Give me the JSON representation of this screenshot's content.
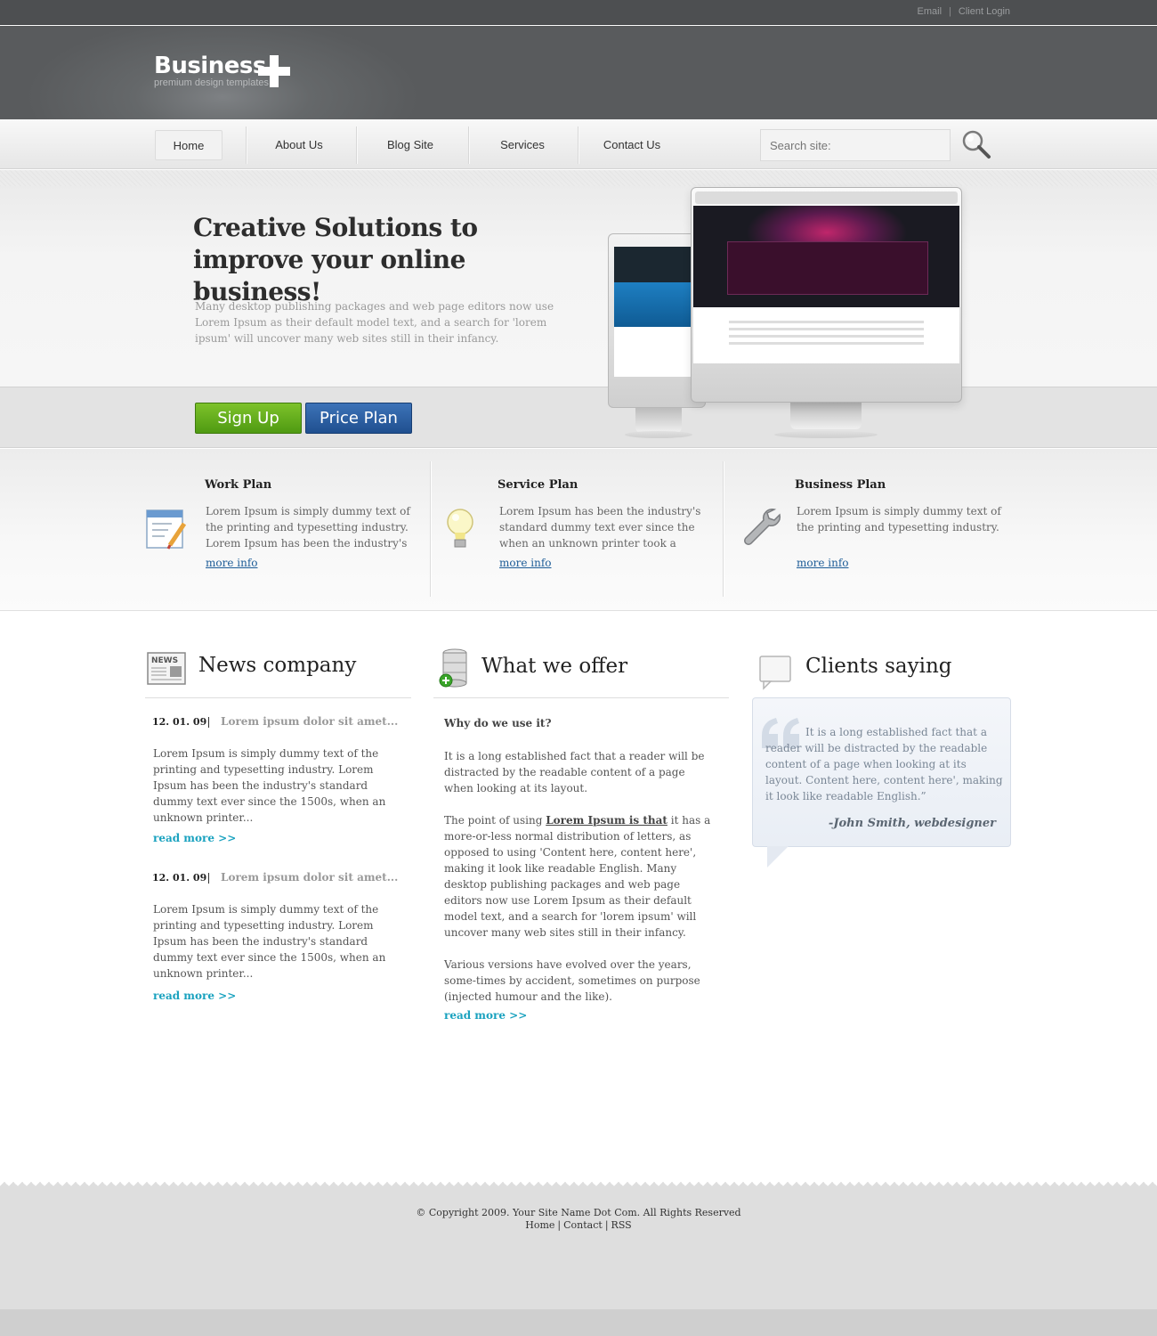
{
  "top_links": {
    "email": "Email",
    "separator": "|",
    "client_login": "Client Login"
  },
  "logo": {
    "word": "Business",
    "tagline": "premium design templates"
  },
  "nav": {
    "items": [
      "Home",
      "About Us",
      "Blog Site",
      "Services",
      "Contact Us"
    ],
    "active": "Home",
    "search_placeholder": "Search site:"
  },
  "hero": {
    "title": "Creative Solutions to improve your online business!",
    "text": "Many desktop publishing packages and web page editors now use Lorem Ipsum as their default model text, and a search for 'lorem ipsum' will uncover many web sites still in their infancy.",
    "signup_label": "Sign Up",
    "price_label": "Price Plan"
  },
  "features": [
    {
      "title": "Work Plan",
      "text": "Lorem Ipsum is simply dummy text of the printing and typesetting industry. Lorem Ipsum has been the industry's",
      "link": "more info",
      "icon": "notepad-icon"
    },
    {
      "title": "Service Plan",
      "text": "Lorem Ipsum has been the industry's standard dummy text ever since the when an unknown printer took a galley",
      "link": "more info",
      "icon": "lightbulb-icon"
    },
    {
      "title": "Business Plan",
      "text": "Lorem Ipsum is simply dummy text of the printing and typesetting industry.",
      "link": "more info",
      "icon": "wrench-icon"
    }
  ],
  "news": {
    "heading": "News company",
    "items": [
      {
        "date": "12. 01. 09",
        "title": "Lorem ipsum dolor sit amet...",
        "text": "Lorem Ipsum is simply dummy text of the printing and typesetting industry. Lorem Ipsum has been the industry's standard dummy text ever since the 1500s, when an unknown printer...",
        "link": "read more >>"
      },
      {
        "date": "12. 01. 09",
        "title": "Lorem ipsum dolor sit amet...",
        "text": "Lorem Ipsum is simply dummy text of the printing and typesetting industry. Lorem Ipsum has been the industry's standard dummy text ever since the 1500s, when an unknown printer...",
        "link": "read more >>"
      }
    ]
  },
  "offer": {
    "heading": "What we offer",
    "question": "Why do we use it?",
    "p1": "It is a long established fact that a reader will be distracted by the readable content of a page when looking at its layout.",
    "p2_before": "The point of using",
    "p2_link": "Lorem Ipsum is that",
    "p2_after": "it has a more-or-less normal distribution of letters, as opposed to using 'Content here, content here', making it look like readable English. Many desktop publishing packages and web page editors now use Lorem Ipsum as their default model text, and a search for 'lorem ipsum' will uncover many web sites still in their infancy.",
    "p3": "Various versions have evolved over the years, some-times by accident, sometimes on purpose (injected humour and the like).",
    "link": "read more >>"
  },
  "clients": {
    "heading": "Clients saying",
    "quote": "It is a long established fact that a reader will be distracted by the readable content of a page when looking at its layout. Content here, content here', making it look like readable English.”",
    "author": "-John Smith, webdesigner"
  },
  "footer": {
    "copyright": "© Copyright 2009. Your Site Name Dot Com. All Rights Reserved",
    "links": [
      "Home",
      "Contact",
      "RSS"
    ],
    "separator": "|"
  }
}
